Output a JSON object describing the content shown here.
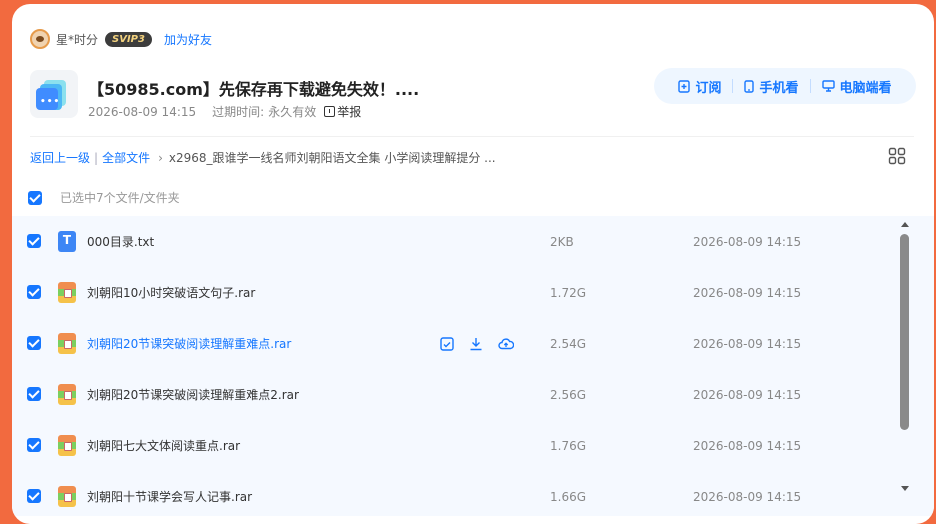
{
  "user": {
    "name": "星*时分",
    "vip_badge": "SVIP3",
    "add_friend": "加为好友"
  },
  "share": {
    "title": "【50985.com】先保存再下载避免失效！....",
    "date": "2026-08-09 14:15",
    "expire_label": "过期时间:",
    "expire_value": "永久有效",
    "report": "举报"
  },
  "actions": {
    "subscribe": "订阅",
    "mobile": "手机看",
    "desktop": "电脑端看"
  },
  "breadcrumb": {
    "back": "返回上一级",
    "all": "全部文件",
    "arrow": "›",
    "current": "x2968_跟谁学一线名师刘朝阳语文全集 小学阅读理解提分 ..."
  },
  "selection": {
    "text": "已选中7个文件/文件夹"
  },
  "files": [
    {
      "name": "000目录.txt",
      "type": "txt",
      "icon_letter": "T",
      "size": "2KB",
      "date": "2026-08-09 14:15"
    },
    {
      "name": "刘朝阳10小时突破语文句子.rar",
      "type": "rar",
      "size": "1.72G",
      "date": "2026-08-09 14:15"
    },
    {
      "name": "刘朝阳20节课突破阅读理解重难点.rar",
      "type": "rar",
      "size": "2.54G",
      "date": "2026-08-09 14:15",
      "hovered": true
    },
    {
      "name": "刘朝阳20节课突破阅读理解重难点2.rar",
      "type": "rar",
      "size": "2.56G",
      "date": "2026-08-09 14:15"
    },
    {
      "name": "刘朝阳七大文体阅读重点.rar",
      "type": "rar",
      "size": "1.76G",
      "date": "2026-08-09 14:15"
    },
    {
      "name": "刘朝阳十节课学会写人记事.rar",
      "type": "rar",
      "size": "1.66G",
      "date": "2026-08-09 14:15"
    }
  ],
  "colors": {
    "background": "#f26a3f",
    "accent": "#1677ff",
    "list_bg": "#f5f9ff"
  }
}
